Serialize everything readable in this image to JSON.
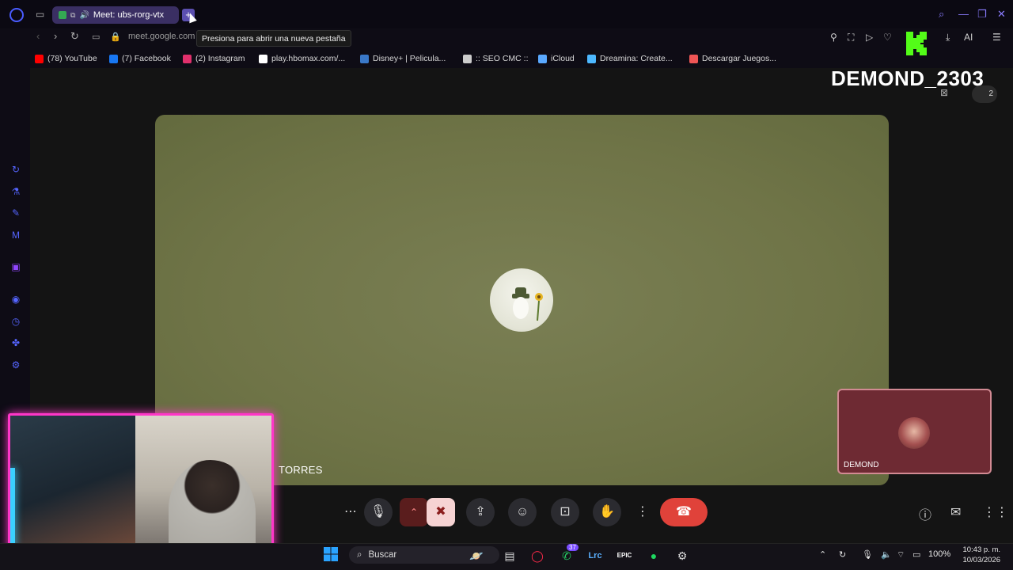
{
  "browser": {
    "tab_title": "Meet: ubs-rorg-vtx",
    "new_tab_tooltip": "Presiona para abrir una nueva pestaña",
    "url": "meet.google.com",
    "ai_label": "AI"
  },
  "bookmarks": [
    {
      "label": "(78) YouTube",
      "icon": "youtube-icon",
      "color": "#ff0000"
    },
    {
      "label": "(7) Facebook",
      "icon": "facebook-icon",
      "color": "#1877f2"
    },
    {
      "label": "(2) Instagram",
      "icon": "instagram-icon",
      "color": "#e1306c"
    },
    {
      "label": "play.hbomax.com/...",
      "icon": "hbomax-icon",
      "color": "#ffffff"
    },
    {
      "label": "Disney+ | Pelicula...",
      "icon": "disney-icon",
      "color": "#3a78c8"
    },
    {
      "label": ":: SEO CMC ::",
      "icon": "page-icon",
      "color": "#cccccc"
    },
    {
      "label": "iCloud",
      "icon": "cloud-icon",
      "color": "#5aa9ff"
    },
    {
      "label": "Dreamina: Create...",
      "icon": "dreamina-icon",
      "color": "#4db8ff"
    },
    {
      "label": "Descargar Juegos...",
      "icon": "download-icon",
      "color": "#e55"
    }
  ],
  "meet": {
    "main_participant_name": "TORRES",
    "self_name": "DEMOND",
    "participant_count": "2"
  },
  "overlay": {
    "streamer_name": "DEMOND_2303"
  },
  "taskbar": {
    "search_placeholder": "Buscar",
    "whatsapp_badge": "37",
    "battery": "100%",
    "time": "10:43 p. m.",
    "date": "10/03/2026"
  },
  "colors": {
    "accent": "#5b4fb0",
    "end_call": "#e0423a",
    "webcam_border": "#ff36c8"
  }
}
